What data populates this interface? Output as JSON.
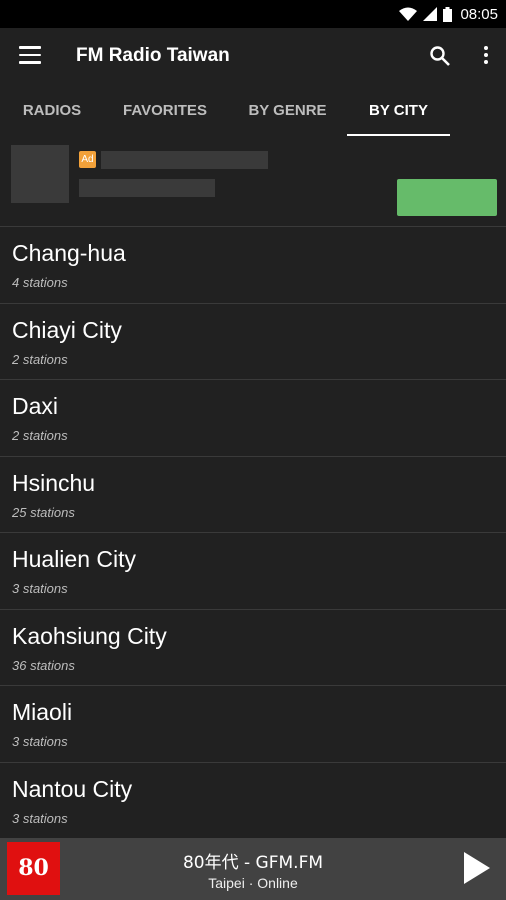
{
  "status_bar": {
    "time": "08:05",
    "icons": [
      "wifi-icon",
      "signal-icon",
      "battery-icon"
    ]
  },
  "app_bar": {
    "title": "FM Radio Taiwan",
    "icons": [
      "menu-icon",
      "search-icon",
      "more-vert-icon"
    ]
  },
  "tabs": [
    {
      "label": "RADIOS",
      "active": false
    },
    {
      "label": "FAVORITES",
      "active": false
    },
    {
      "label": "BY GENRE",
      "active": false
    },
    {
      "label": "BY CITY",
      "active": true
    }
  ],
  "ad": {
    "badge": "Ad",
    "cta_color": "#66bb6a"
  },
  "cities": [
    {
      "name": "Chang-hua",
      "count": "4 stations"
    },
    {
      "name": "Chiayi City",
      "count": "2 stations"
    },
    {
      "name": "Daxi",
      "count": "2 stations"
    },
    {
      "name": "Hsinchu",
      "count": "25 stations"
    },
    {
      "name": "Hualien City",
      "count": "3 stations"
    },
    {
      "name": "Kaohsiung City",
      "count": "36 stations"
    },
    {
      "name": "Miaoli",
      "count": "3 stations"
    },
    {
      "name": "Nantou City",
      "count": "3 stations"
    }
  ],
  "player": {
    "logo_text": "80",
    "title": "80年代 - GFM.FM",
    "subtitle": "Taipei · Online",
    "logo_color": "#e01010"
  }
}
